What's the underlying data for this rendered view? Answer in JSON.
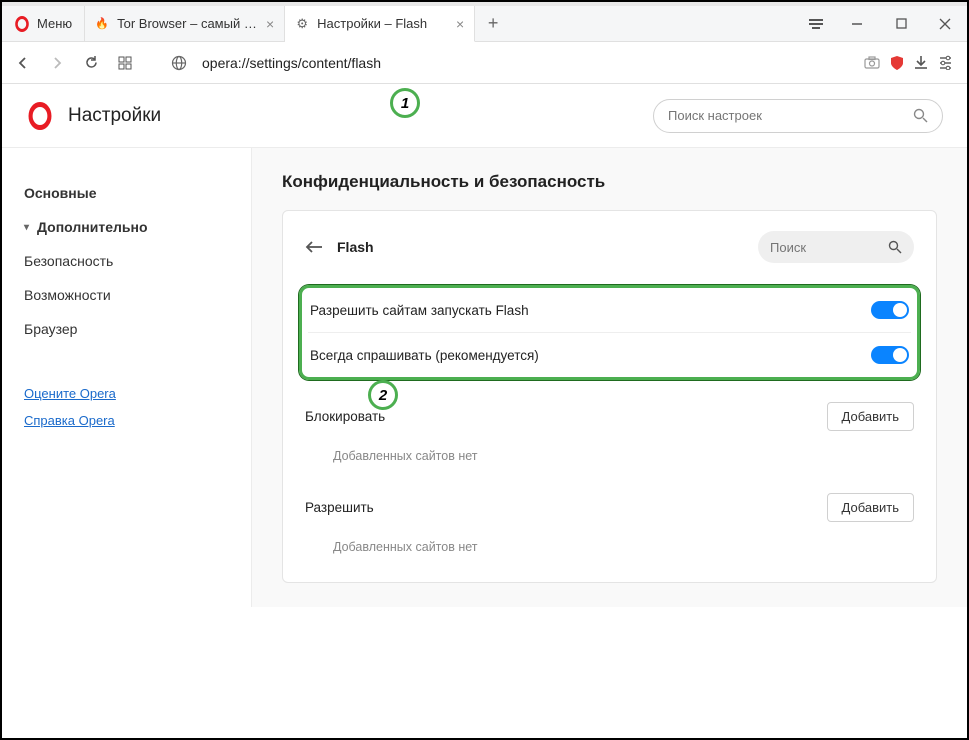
{
  "titlebar": {
    "menu": "Меню",
    "tabs": [
      {
        "label": "Tor Browser – самый защи",
        "icon": "tor"
      },
      {
        "label": "Настройки – Flash",
        "icon": "gear"
      }
    ],
    "new_tab": "+"
  },
  "addressbar": {
    "url": "opera://settings/content/flash"
  },
  "settings": {
    "title": "Настройки",
    "search_placeholder": "Поиск настроек"
  },
  "sidebar": {
    "basic": "Основные",
    "advanced": "Дополнительно",
    "sub": [
      "Безопасность",
      "Возможности",
      "Браузер"
    ],
    "links": [
      "Оцените Opera",
      "Справка Opera"
    ]
  },
  "main": {
    "section": "Конфиденциальность и безопасность",
    "card_title": "Flash",
    "card_search_placeholder": "Поиск",
    "toggles": [
      {
        "label": "Разрешить сайтам запускать Flash",
        "on": true
      },
      {
        "label": "Всегда спрашивать (рекомендуется)",
        "on": true
      }
    ],
    "block": {
      "title": "Блокировать",
      "empty": "Добавленных сайтов нет",
      "add": "Добавить"
    },
    "allow": {
      "title": "Разрешить",
      "empty": "Добавленных сайтов нет",
      "add": "Добавить"
    }
  },
  "markers": {
    "m1": "1",
    "m2": "2"
  }
}
